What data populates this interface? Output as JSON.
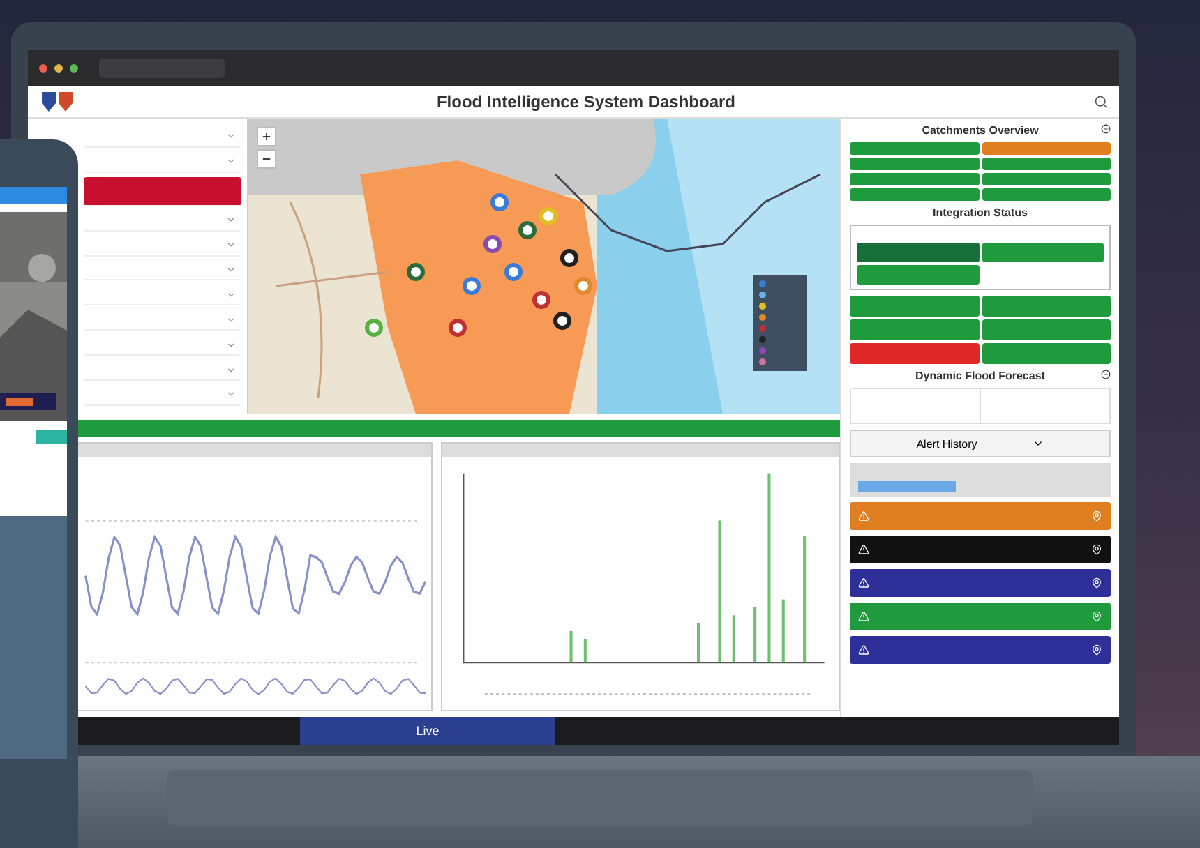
{
  "dashboard": {
    "title": "Flood Intelligence System Dashboard"
  },
  "sidebar": {
    "items": [
      {
        "selected": false
      },
      {
        "selected": false
      },
      {
        "selected": true
      },
      {
        "selected": false
      },
      {
        "selected": false
      },
      {
        "selected": false
      },
      {
        "selected": false
      },
      {
        "selected": false
      },
      {
        "selected": false
      },
      {
        "selected": false
      },
      {
        "selected": false
      }
    ]
  },
  "map": {
    "legend": [
      {
        "color": "#3a7bd5"
      },
      {
        "color": "#6ab0e0"
      },
      {
        "color": "#e0c020"
      },
      {
        "color": "#e08a30"
      },
      {
        "color": "#c03030"
      },
      {
        "color": "#202020"
      },
      {
        "color": "#8a4ab0"
      },
      {
        "color": "#d070a0"
      }
    ]
  },
  "catchments": {
    "title": "Catchments Overview",
    "tiles": [
      {
        "color": "#1f9a3c"
      },
      {
        "color": "#e07f22"
      },
      {
        "color": "#1f9a3c"
      },
      {
        "color": "#1f9a3c"
      },
      {
        "color": "#1f9a3c"
      },
      {
        "color": "#1f9a3c"
      },
      {
        "color": "#1f9a3c"
      },
      {
        "color": "#1f9a3c"
      }
    ]
  },
  "integration": {
    "title": "Integration Status",
    "group_tiles": [
      {
        "color": "#17703a"
      },
      {
        "color": "#1f9a3c"
      },
      {
        "color": "#1f9a3c"
      }
    ],
    "tiles": [
      {
        "color": "#1f9a3c"
      },
      {
        "color": "#1f9a3c"
      },
      {
        "color": "#1f9a3c"
      },
      {
        "color": "#1f9a3c"
      },
      {
        "color": "#e02828"
      },
      {
        "color": "#1f9a3c"
      }
    ]
  },
  "forecast": {
    "title": "Dynamic Flood Forecast"
  },
  "alerts": {
    "title": "Alert History",
    "cards": [
      {
        "color": "#e07f22"
      },
      {
        "color": "#111111"
      },
      {
        "color": "#2f2f9a"
      },
      {
        "color": "#1f9a3c"
      },
      {
        "color": "#2f2f9a"
      }
    ]
  },
  "footer": {
    "live_button": "Live"
  }
}
